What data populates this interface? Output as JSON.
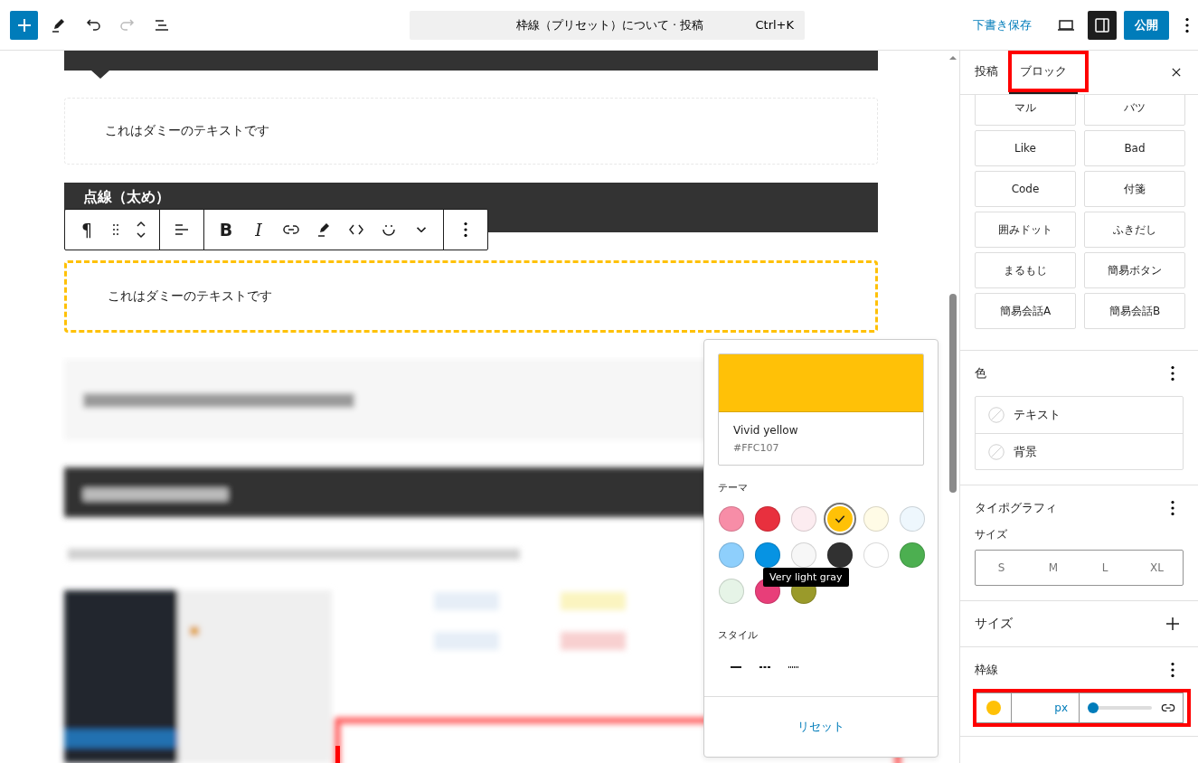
{
  "top_bar": {
    "title": "枠線（プリセット）について · 投稿",
    "shortcut": "Ctrl+K",
    "save_draft": "下書き保存",
    "settings_panel_open": true,
    "publish": "公開"
  },
  "editor": {
    "paragraph_1": "これはダミーのテキストです",
    "heading": "点線（太め）",
    "paragraph_2": "これはダミーのテキストです"
  },
  "block_toolbar": {
    "block_type": "¶",
    "bold": "B",
    "italic": "I"
  },
  "color_popover": {
    "color_name": "Vivid yellow",
    "color_hex": "#FFC107",
    "theme_label": "テーマ",
    "swatches": [
      {
        "color": "#f78da7",
        "selected": false
      },
      {
        "color": "#e8303e",
        "selected": false
      },
      {
        "color": "#fcecf0",
        "selected": false
      },
      {
        "color": "#ffc107",
        "selected": true
      },
      {
        "color": "#fffbe6",
        "selected": false
      },
      {
        "color": "#eef7fd",
        "selected": false
      },
      {
        "color": "#8ecffc",
        "selected": false
      },
      {
        "color": "#0693e3",
        "selected": false
      },
      {
        "color": "#f7f7f7",
        "selected": false
      },
      {
        "color": "#313131",
        "selected": false
      },
      {
        "color": "#ffffff",
        "selected": false
      },
      {
        "color": "#4caf50",
        "selected": false
      },
      {
        "color": "#e6f4e7",
        "selected": false
      },
      {
        "color": "#e83e79",
        "selected": false
      },
      {
        "color": "#9a9a2a",
        "selected": false
      }
    ],
    "tooltip": "Very light gray",
    "style_label": "スタイル",
    "reset": "リセット"
  },
  "sidebar": {
    "tabs": [
      {
        "label": "投稿",
        "selected": false
      },
      {
        "label": "ブロック",
        "selected": true
      }
    ],
    "style_buttons": [
      "マル",
      "バツ",
      "Like",
      "Bad",
      "Code",
      "付箋",
      "囲みドット",
      "ふきだし",
      "まるもじ",
      "簡易ボタン",
      "簡易会話A",
      "簡易会話B"
    ],
    "color_panel": {
      "title": "色",
      "items": [
        "テキスト",
        "背景"
      ]
    },
    "typography_panel": {
      "title": "タイポグラフィ",
      "size_label": "サイズ",
      "sizes": [
        {
          "label": "S",
          "selected": false
        },
        {
          "label": "M",
          "selected": false
        },
        {
          "label": "L",
          "selected": false
        },
        {
          "label": "XL",
          "selected": false
        }
      ]
    },
    "size_panel": {
      "title": "サイズ"
    },
    "border_panel": {
      "title": "枠線",
      "color": "#ffc107",
      "unit": "px",
      "level": 0
    }
  }
}
